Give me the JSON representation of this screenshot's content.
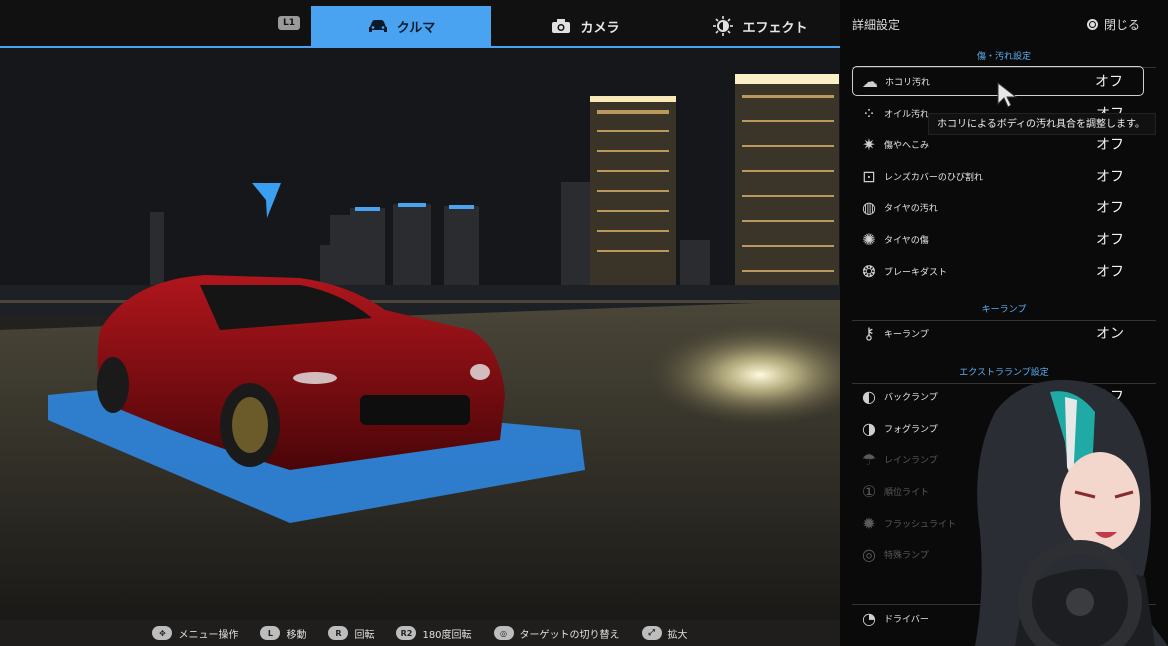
{
  "topbar": {
    "l1": "L1",
    "tabs": [
      {
        "label": "クルマ",
        "icon": "car-icon",
        "active": true
      },
      {
        "label": "カメラ",
        "icon": "camera-icon",
        "active": false
      },
      {
        "label": "エフェクト",
        "icon": "effect-icon",
        "active": false
      }
    ]
  },
  "panel": {
    "title": "詳細設定",
    "close_label": "閉じる",
    "sections": [
      {
        "heading": "傷・汚れ設定",
        "rows": [
          {
            "label": "ホコリ汚れ",
            "value": "オフ",
            "icon": "cloud-icon"
          },
          {
            "label": "オイル汚れ",
            "value": "オフ",
            "icon": "drops-icon"
          },
          {
            "label": "傷やへこみ",
            "value": "オフ",
            "icon": "scratch-icon"
          },
          {
            "label": "レンズカバーのひび割れ",
            "value": "オフ",
            "icon": "lens-crack-icon"
          },
          {
            "label": "タイヤの汚れ",
            "value": "オフ",
            "icon": "tire-dirt-icon"
          },
          {
            "label": "タイヤの傷",
            "value": "オフ",
            "icon": "tire-damage-icon"
          },
          {
            "label": "ブレーキダスト",
            "value": "オフ",
            "icon": "brake-dust-icon"
          }
        ]
      },
      {
        "heading": "キーランプ",
        "rows": [
          {
            "label": "キーランプ",
            "value": "オン",
            "icon": "key-icon"
          }
        ]
      },
      {
        "heading": "エクストラランプ設定",
        "rows": [
          {
            "label": "バックランプ",
            "value": "オフ",
            "icon": "back-lamp-icon"
          },
          {
            "label": "フォグランプ",
            "value": "",
            "icon": "fog-lamp-icon"
          },
          {
            "label": "レインランプ",
            "value": "",
            "icon": "rain-lamp-icon"
          },
          {
            "label": "順位ライト",
            "value": "",
            "icon": "position-light-icon"
          },
          {
            "label": "フラッシュライト",
            "value": "",
            "icon": "flash-light-icon"
          },
          {
            "label": "特殊ランプ",
            "value": "",
            "icon": "special-lamp-icon"
          }
        ]
      },
      {
        "heading": "クルマ",
        "rows": [
          {
            "label": "ドライバー",
            "value": "",
            "icon": "driver-icon"
          }
        ]
      }
    ],
    "tooltip": "ホコリによるボディの汚れ具合を調整します。"
  },
  "hints": [
    {
      "button": "✥",
      "label": "メニュー操作"
    },
    {
      "button": "L",
      "label": "移動"
    },
    {
      "button": "R",
      "label": "回転"
    },
    {
      "button": "R2",
      "label": "180度回転"
    },
    {
      "button": "◎",
      "label": "ターゲットの切り替え"
    },
    {
      "button": "⤢",
      "label": "拡大"
    }
  ],
  "colors": {
    "accent": "#4aa3f0",
    "car": "#8a0d12",
    "platform": "#2f86e0"
  }
}
